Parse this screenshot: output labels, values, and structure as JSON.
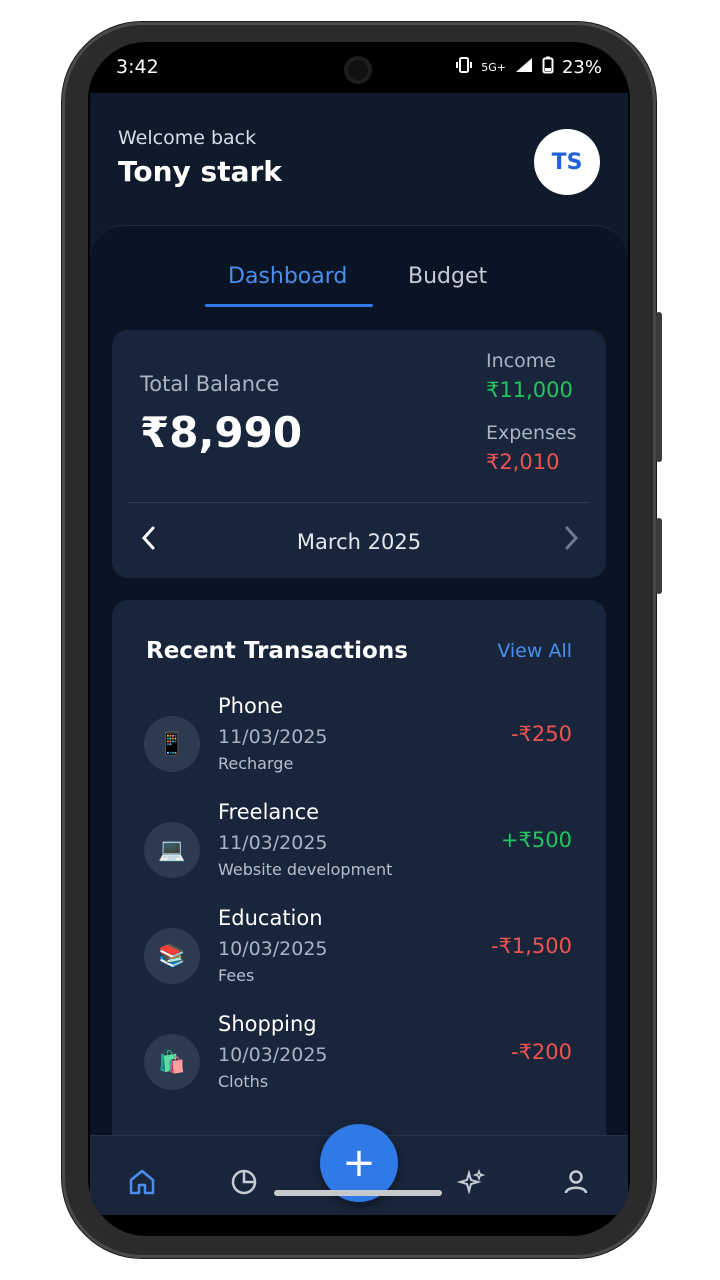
{
  "status_bar": {
    "time": "3:42",
    "network": "5G+",
    "battery": "23%"
  },
  "header": {
    "welcome": "Welcome back",
    "username": "Tony stark",
    "avatar_initials": "TS"
  },
  "tabs": [
    {
      "label": "Dashboard",
      "active": true
    },
    {
      "label": "Budget",
      "active": false
    }
  ],
  "balance": {
    "label": "Total Balance",
    "value": "₹8,990",
    "income_label": "Income",
    "income_value": "₹11,000",
    "expenses_label": "Expenses",
    "expenses_value": "₹2,010",
    "month": "March 2025"
  },
  "transactions": {
    "title": "Recent Transactions",
    "view_all": "View All",
    "items": [
      {
        "icon": "📱",
        "name": "Phone",
        "date": "11/03/2025",
        "note": "Recharge",
        "amount": "-₹250",
        "type": "expense"
      },
      {
        "icon": "💻",
        "name": "Freelance",
        "date": "11/03/2025",
        "note": "Website development",
        "amount": "+₹500",
        "type": "income"
      },
      {
        "icon": "📚",
        "name": "Education",
        "date": "10/03/2025",
        "note": "Fees",
        "amount": "-₹1,500",
        "type": "expense"
      },
      {
        "icon": "🛍️",
        "name": "Shopping",
        "date": "10/03/2025",
        "note": "Cloths",
        "amount": "-₹200",
        "type": "expense"
      }
    ]
  },
  "nav": {
    "items": [
      "home-icon",
      "pie-chart-icon",
      "add-icon",
      "sparkles-icon",
      "user-icon"
    ],
    "fab": "+"
  },
  "colors": {
    "accent": "#2f7ae6",
    "income": "#22c55e",
    "expense": "#ef5350",
    "background": "#0f1a2b"
  }
}
